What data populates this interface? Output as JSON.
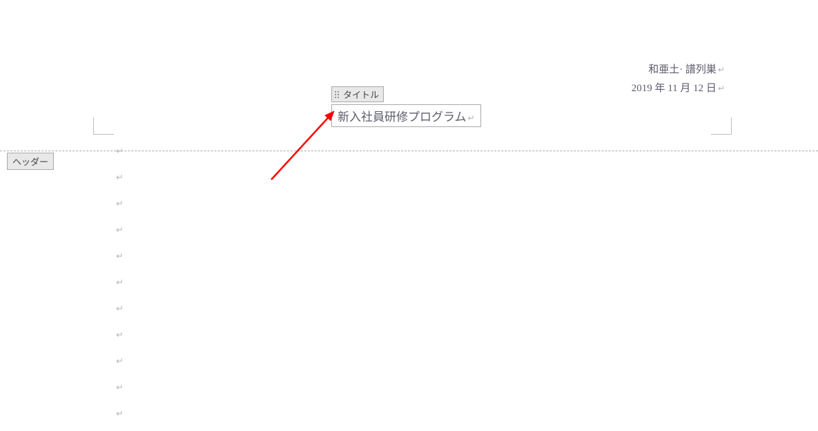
{
  "header": {
    "author": "和亜土· 譜列巣",
    "date": "2019 年 11 月 12 日"
  },
  "title": {
    "tag_label": "タイトル",
    "text": "新入社員研修プログラム"
  },
  "labels": {
    "header_region": "ヘッダー"
  },
  "marks": {
    "return": "↵",
    "paragraph_count": 11
  },
  "annotation": {
    "arrow_color": "#ff0000"
  }
}
